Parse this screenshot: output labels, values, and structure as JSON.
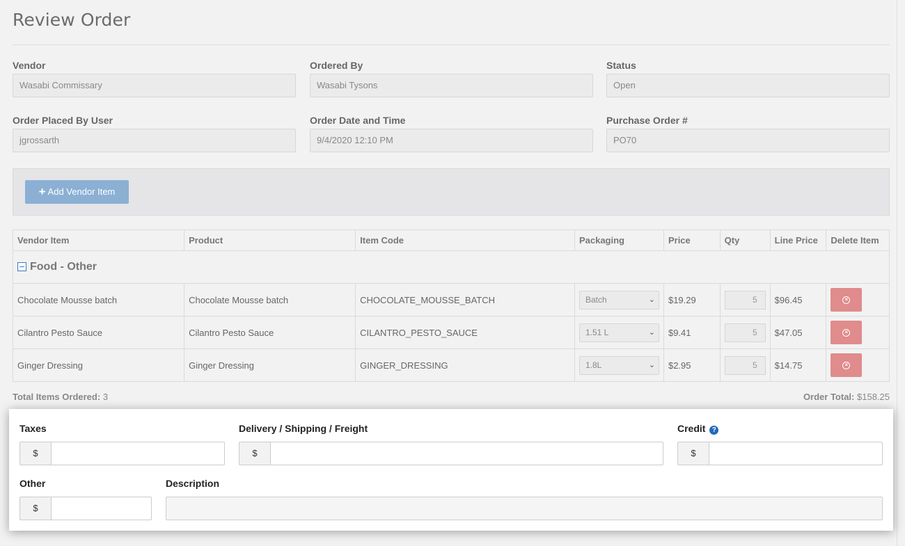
{
  "page": {
    "title": "Review Order"
  },
  "fields": {
    "vendor": {
      "label": "Vendor",
      "value": "Wasabi Commissary"
    },
    "ordered_by": {
      "label": "Ordered By",
      "value": "Wasabi Tysons"
    },
    "status": {
      "label": "Status",
      "value": "Open"
    },
    "placed_by": {
      "label": "Order Placed By User",
      "value": "jgrossarth"
    },
    "order_datetime": {
      "label": "Order Date and Time",
      "value": "9/4/2020 12:10 PM"
    },
    "po_number": {
      "label": "Purchase Order #",
      "value": "PO70"
    }
  },
  "toolbar": {
    "add_label": "Add Vendor Item",
    "add_icon": "plus-icon"
  },
  "table": {
    "headers": [
      "Vendor Item",
      "Product",
      "Item Code",
      "Packaging",
      "Price",
      "Qty",
      "Line Price",
      "Delete Item"
    ],
    "group": "Food - Other",
    "rows": [
      {
        "vendor_item": "Chocolate Mousse batch",
        "product": "Chocolate Mousse batch",
        "code": "CHOCOLATE_MOUSSE_BATCH",
        "packaging": "Batch",
        "price": "$19.29",
        "qty": "5",
        "line_price": "$96.45"
      },
      {
        "vendor_item": "Cilantro Pesto Sauce",
        "product": "Cilantro Pesto Sauce",
        "code": "CILANTRO_PESTO_SAUCE",
        "packaging": "1.51 L",
        "price": "$9.41",
        "qty": "5",
        "line_price": "$47.05"
      },
      {
        "vendor_item": "Ginger Dressing",
        "product": "Ginger Dressing",
        "code": "GINGER_DRESSING",
        "packaging": "1.8L",
        "price": "$2.95",
        "qty": "5",
        "line_price": "$14.75"
      }
    ]
  },
  "totals": {
    "items_label": "Total Items Ordered:",
    "items_value": "3",
    "order_label": "Order Total:",
    "order_value": "$158.25"
  },
  "charges": {
    "currency": "$",
    "taxes_label": "Taxes",
    "delivery_label": "Delivery / Shipping / Freight",
    "credit_label": "Credit",
    "credit_help": "?",
    "other_label": "Other",
    "description_label": "Description"
  },
  "colors": {
    "accent": "#8bb0d4",
    "danger": "#e08b8c",
    "help": "#2069b8"
  }
}
